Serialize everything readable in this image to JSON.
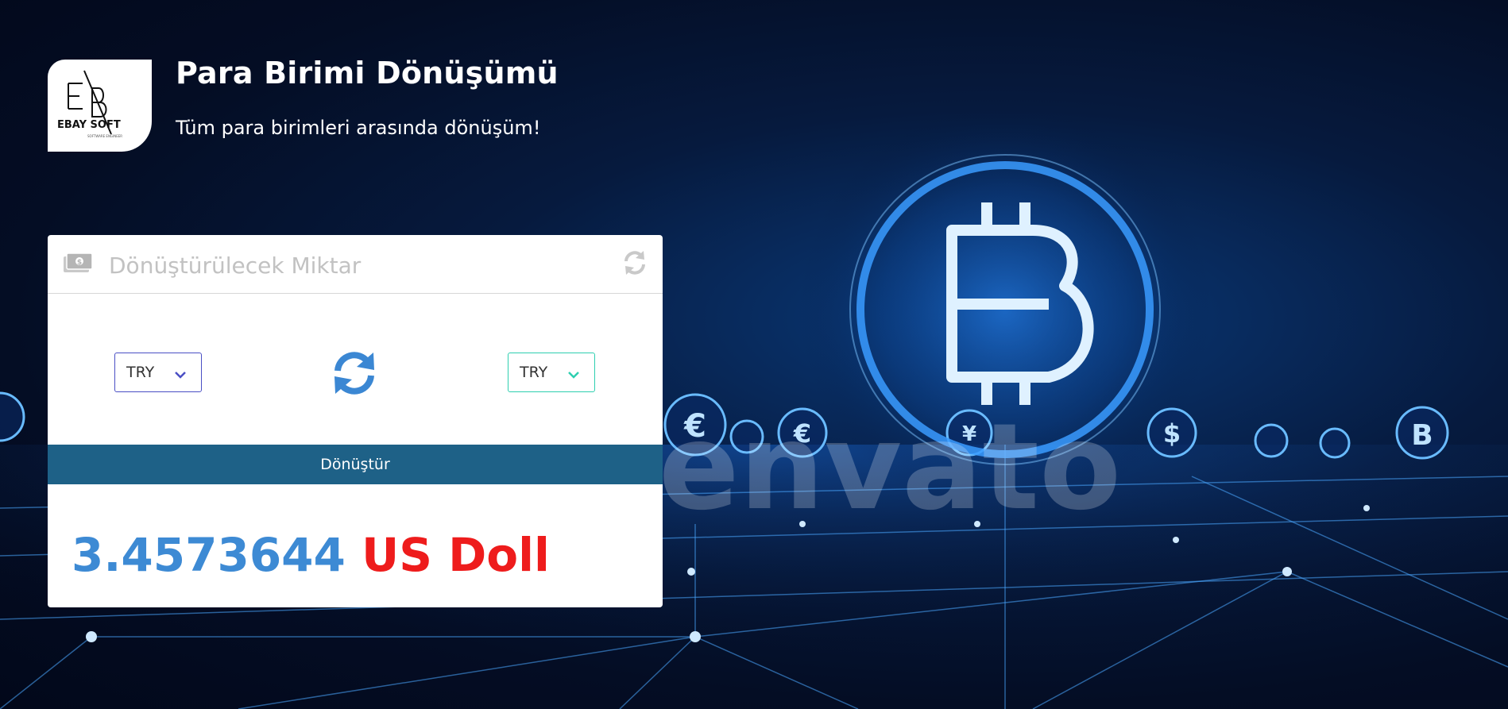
{
  "header": {
    "title": "Para Birimi Dönüşümü",
    "subtitle": "Tüm para birimleri arasında dönüşüm!",
    "logo_text": "EBAY SOFT",
    "logo_tagline": "SOFTWARE ENGINEER"
  },
  "converter": {
    "amount_placeholder": "Dönüştürülecek Miktar",
    "amount_value": "",
    "from_currency": "TRY",
    "to_currency": "TRY",
    "convert_label": "Dönüştür",
    "result_value": "3.4573644",
    "result_currency": "US Doll"
  },
  "background": {
    "watermark_text": "envato"
  },
  "icons": {
    "money": "money-bill-icon",
    "refresh": "refresh-icon",
    "swap": "swap-arrows-icon",
    "chevron": "chevron-down-icon"
  },
  "colors": {
    "primary_button": "#1e6187",
    "result_number": "#3d8ad4",
    "result_currency": "#ee1c1c",
    "from_select_border": "#4a4fc4",
    "to_select_border": "#2ecfb0",
    "swap_icon": "#3b87d3"
  }
}
